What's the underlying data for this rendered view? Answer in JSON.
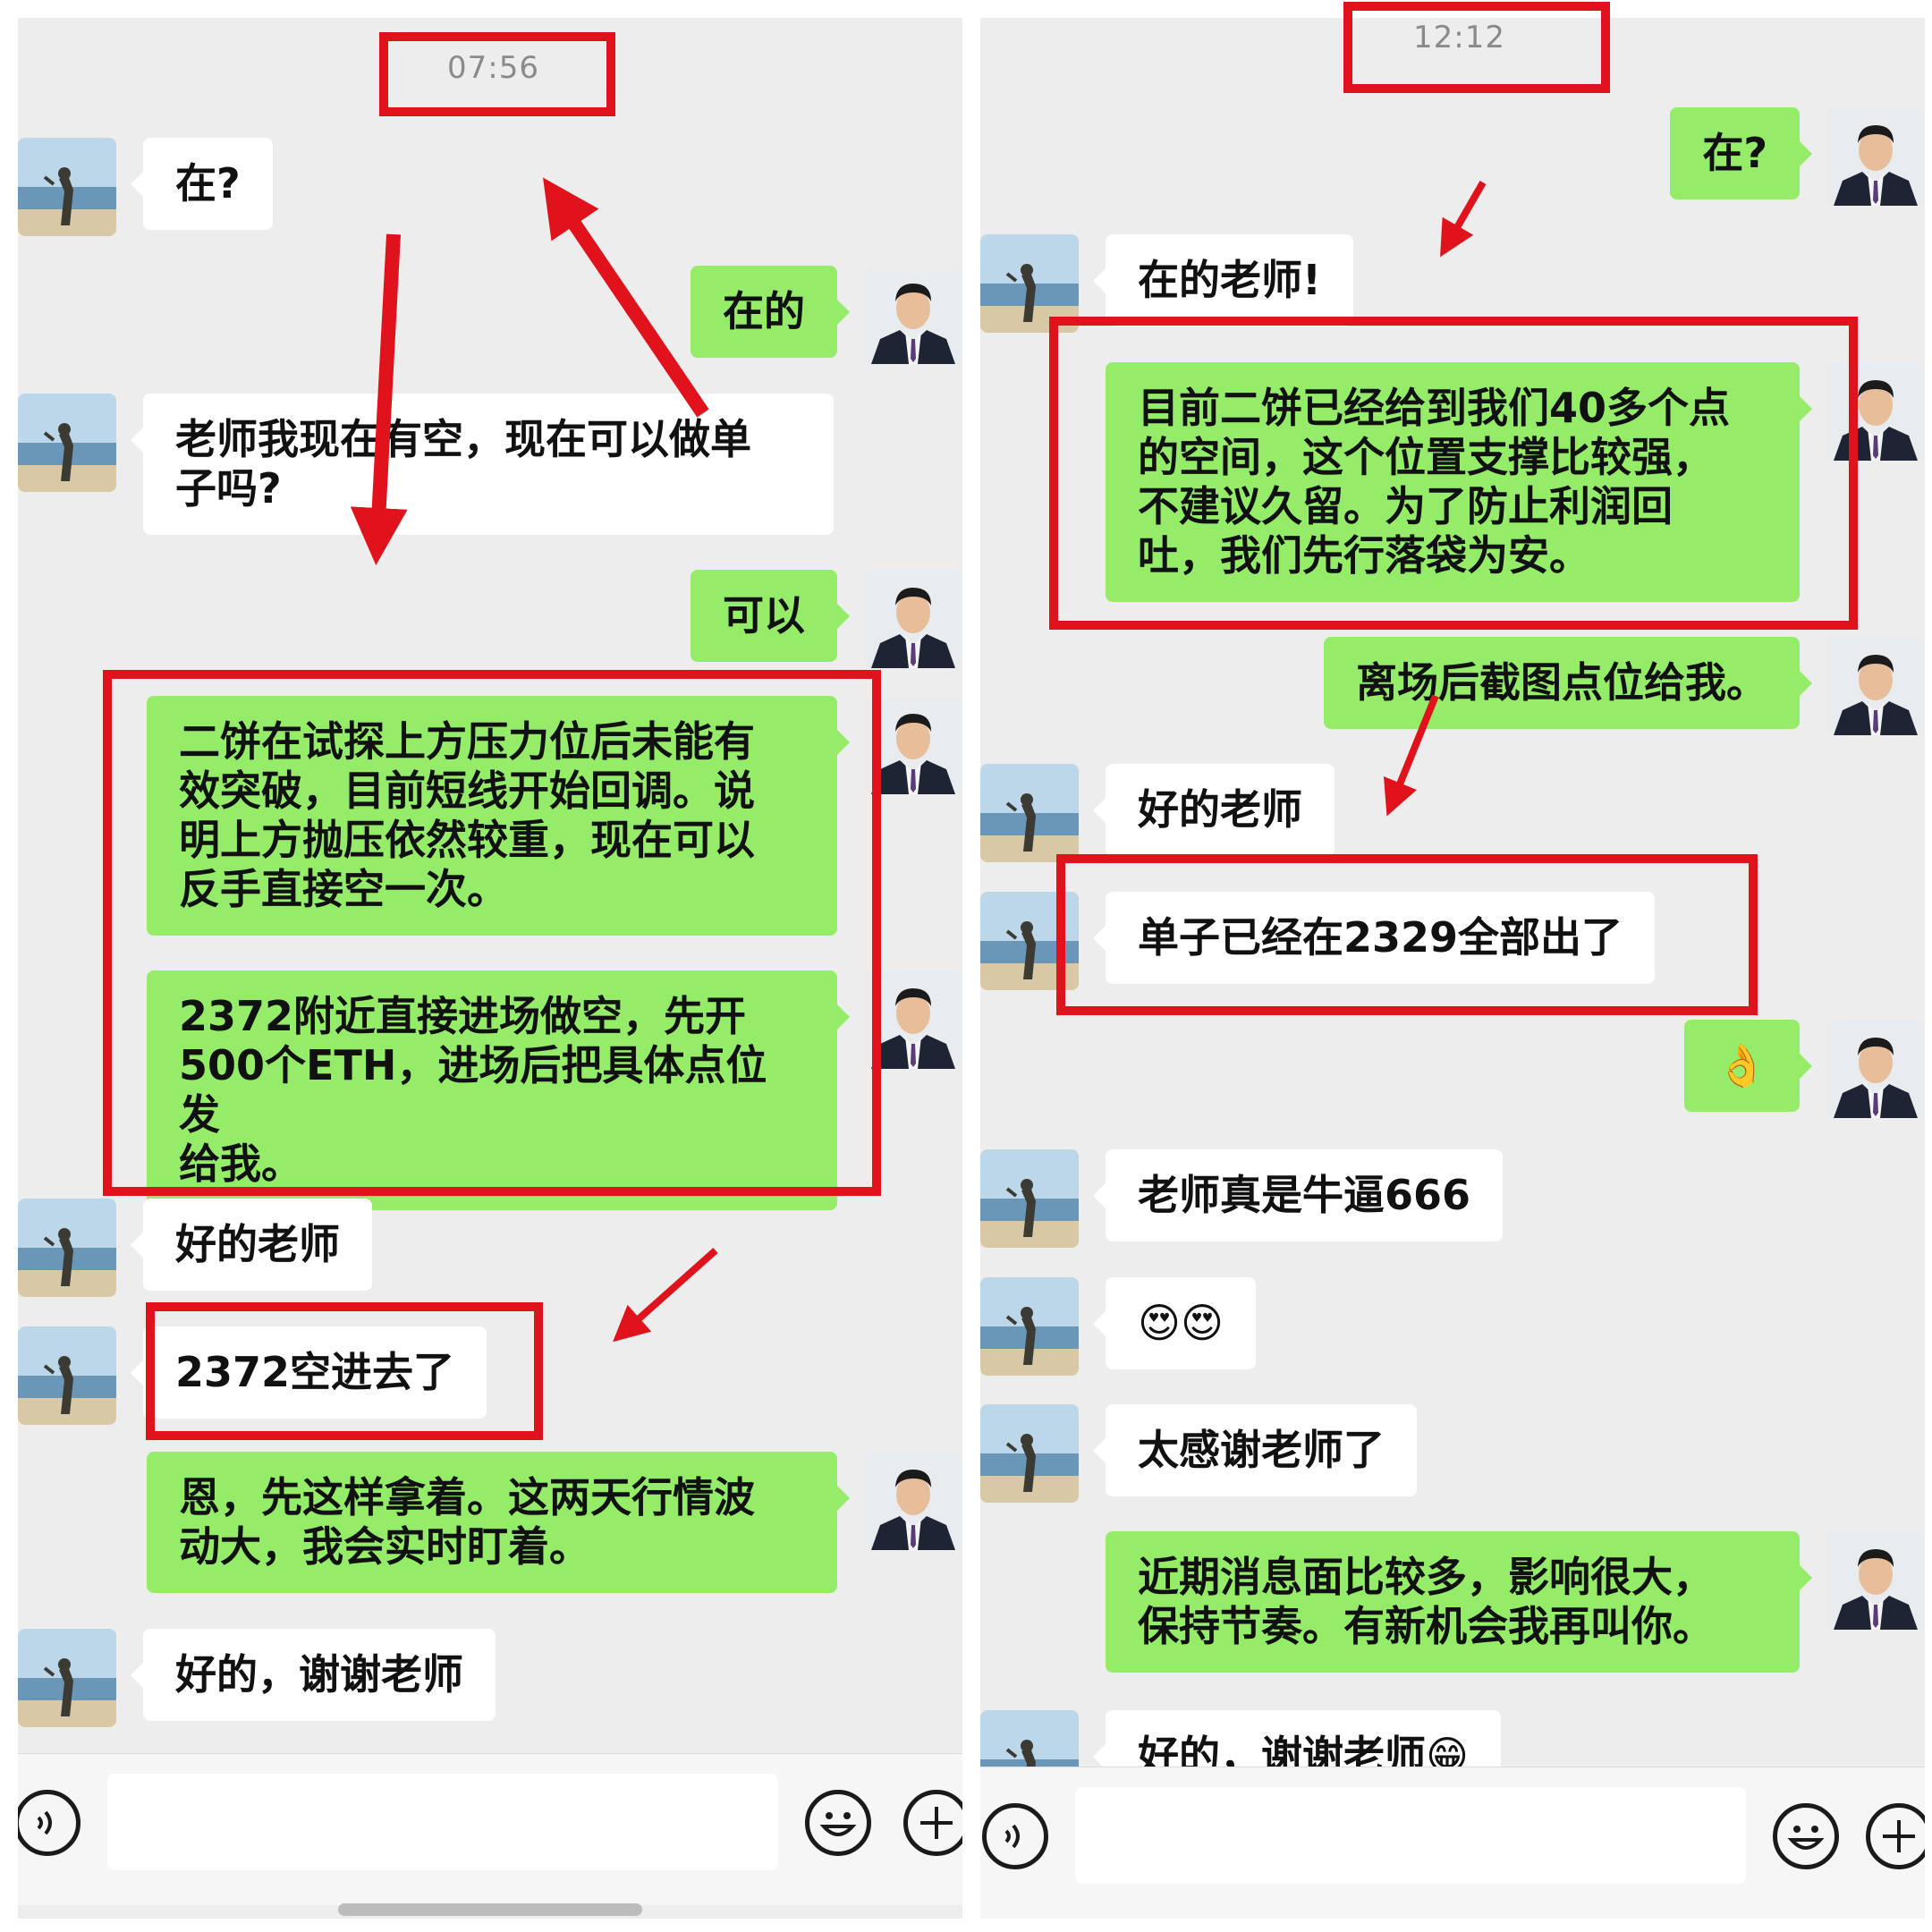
{
  "left_chat": {
    "time": "07:56",
    "messages": [
      {
        "side": "in",
        "text": "在?"
      },
      {
        "side": "out",
        "text": "在的"
      },
      {
        "side": "in",
        "text": "老师我现在有空，现在可以做单\n子吗?"
      },
      {
        "side": "out",
        "text": "可以"
      },
      {
        "side": "out",
        "text": "二饼在试探上方压力位后未能有\n效突破，目前短线开始回调。说\n明上方抛压依然较重，现在可以\n反手直接空一次。"
      },
      {
        "side": "out",
        "text": "2372附近直接进场做空，先开\n500个ETH，进场后把具体点位发\n给我。"
      },
      {
        "side": "in",
        "text": "好的老师"
      },
      {
        "side": "in",
        "text": "2372空进去了"
      },
      {
        "side": "out",
        "text": "恩，先这样拿着。这两天行情波\n动大，我会实时盯着。"
      },
      {
        "side": "in",
        "text": "好的，谢谢老师"
      }
    ]
  },
  "right_chat": {
    "time": "12:12",
    "messages": [
      {
        "side": "out",
        "text": "在?"
      },
      {
        "side": "in",
        "text": "在的老师!"
      },
      {
        "side": "out",
        "text": "目前二饼已经给到我们40多个点\n的空间，这个位置支撑比较强，\n不建议久留。为了防止利润回\n吐，我们先行落袋为安。"
      },
      {
        "side": "out",
        "text": "离场后截图点位给我。"
      },
      {
        "side": "in",
        "text": "好的老师"
      },
      {
        "side": "in",
        "text": "单子已经在2329全部出了"
      },
      {
        "side": "out",
        "text": "👌"
      },
      {
        "side": "in",
        "text": "老师真是牛逼666"
      },
      {
        "side": "in",
        "text": "😍😍"
      },
      {
        "side": "in",
        "text": "太感谢老师了"
      },
      {
        "side": "out",
        "text": "近期消息面比较多，影响很大，\n保持节奏。有新机会我再叫你。"
      },
      {
        "side": "in",
        "text": "好的，谢谢老师😁"
      }
    ]
  },
  "icons": {
    "voice": "voice-icon",
    "emoji": "emoji-icon",
    "add": "plus-icon"
  },
  "colors": {
    "chat_background": "#ededed",
    "sent_bubble": "#95ec69",
    "received_bubble": "#ffffff",
    "annotation_red": "#e0121b"
  }
}
